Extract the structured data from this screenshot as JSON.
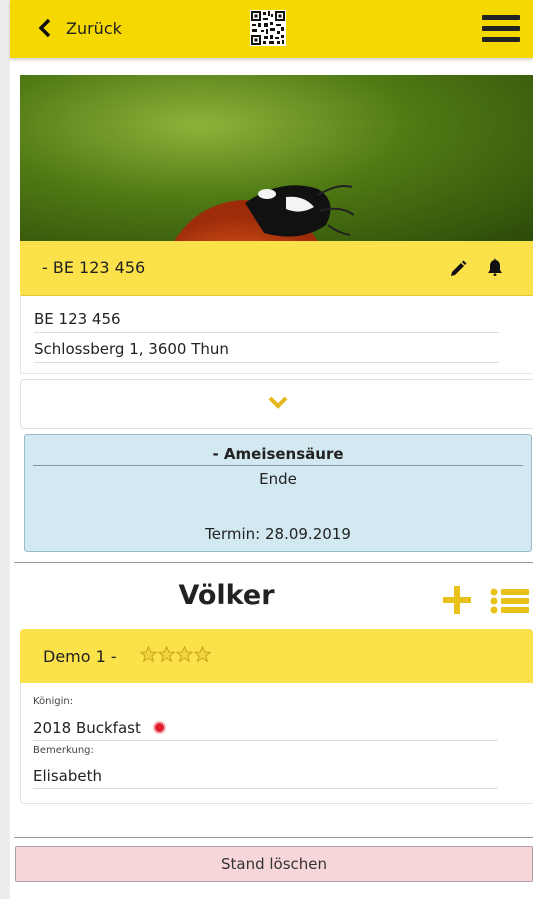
{
  "header": {
    "back_label": "Zurück",
    "back_icon": "chevron-left-icon",
    "qr_icon": "qr-code-icon",
    "menu_icon": "hamburger-menu-icon",
    "bar_color": "#f5d800"
  },
  "stand": {
    "title": "- BE 123 456",
    "number": "BE 123 456",
    "address": "Schlossberg 1, 3600 Thun",
    "header_color": "#fbe14a"
  },
  "treatment": {
    "title": "- Ameisensäure",
    "status": "Ende",
    "date_text": "Termin: 28.09.2019",
    "color": "#d3e9f1"
  },
  "colonies_section": {
    "title": "Völker",
    "add_icon": "plus-icon",
    "list_icon": "list-icon",
    "accent_color": "#e8c11a"
  },
  "colonies": [
    {
      "name": "Demo 1 -",
      "rating": 4,
      "queen_label": "Königin:",
      "queen_value": "2018 Buckfast",
      "queen_marker_color": "#e11d2e",
      "note_label": "Bemerkung:",
      "note_value": "Elisabeth"
    }
  ],
  "actions": {
    "delete_label": "Stand löschen",
    "delete_color": "#f6d6d9"
  }
}
